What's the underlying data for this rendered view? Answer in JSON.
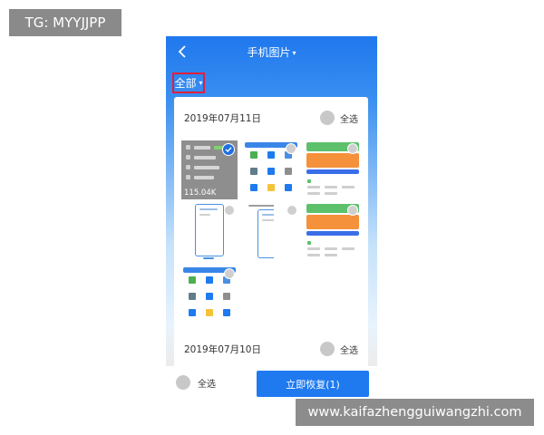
{
  "overlay": {
    "tg_badge": "TG: MYYJJPP",
    "watermark": "www.kaifazhengguiwangzhi.com"
  },
  "header": {
    "title": "手机图片",
    "title_caret": "▾",
    "back_icon": "chevron-left-icon"
  },
  "filter": {
    "label": "全部",
    "caret": "▾"
  },
  "groups": [
    {
      "date": "2019年07月11日",
      "select_all_label": "全选",
      "photos": [
        {
          "kind": "settings-screenshot",
          "selected": true,
          "size_label": "115.04K"
        },
        {
          "kind": "app-grid-screenshot",
          "selected": false
        },
        {
          "kind": "orange-cards-screenshot",
          "selected": false
        },
        {
          "kind": "phone-mockup",
          "selected": false
        },
        {
          "kind": "phone-mockup",
          "selected": false
        },
        {
          "kind": "orange-cards-screenshot",
          "selected": false
        },
        {
          "kind": "app-grid-screenshot",
          "selected": false
        }
      ]
    },
    {
      "date": "2019年07月10日",
      "select_all_label": "全选"
    }
  ],
  "footer": {
    "select_all_label": "全选",
    "restore_button": "立即恢复(1)"
  },
  "colors": {
    "primary_blue": "#1f7af0",
    "selection_highlight": "#e0203c",
    "orange_card": "#f5913a"
  }
}
